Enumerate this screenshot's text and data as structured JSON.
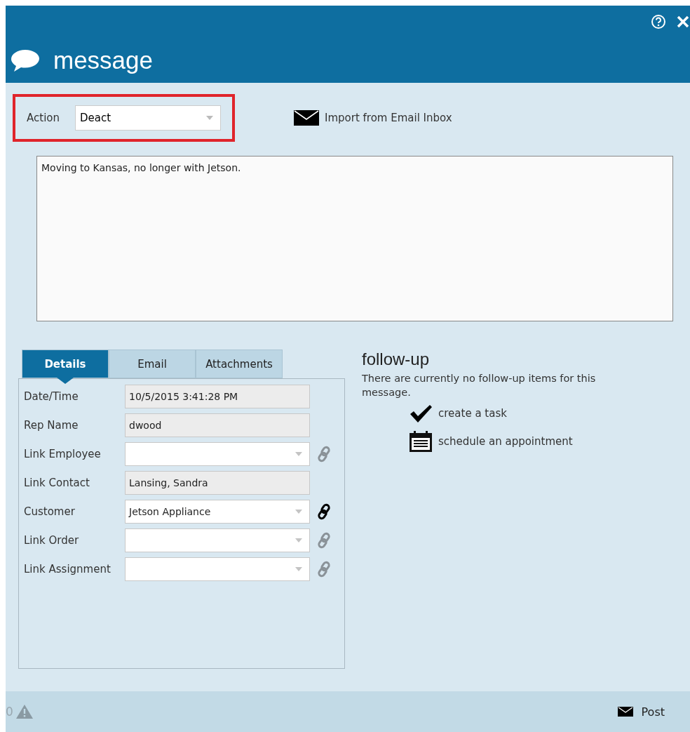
{
  "window": {
    "title": "message"
  },
  "action": {
    "label": "Action",
    "value": "Deact",
    "highlighted": true
  },
  "import_link": "Import from Email Inbox",
  "message_text": "Moving to Kansas, no longer with Jetson.",
  "tabs": [
    {
      "label": "Details",
      "selected": true
    },
    {
      "label": "Email",
      "selected": false
    },
    {
      "label": "Attachments",
      "selected": false
    }
  ],
  "fields": [
    {
      "label": "Date/Time",
      "kind": "readonly",
      "value": "10/5/2015 3:41:28 PM"
    },
    {
      "label": "Rep Name",
      "kind": "readonly",
      "value": "dwood"
    },
    {
      "label": "Link Employee",
      "kind": "dropdown",
      "linked": false
    },
    {
      "label": "Link Contact",
      "kind": "readonly",
      "value": "Lansing, Sandra"
    },
    {
      "label": "Customer",
      "kind": "dropdown",
      "value": "Jetson Appliance",
      "linked": true
    },
    {
      "label": "Link Order",
      "kind": "dropdown",
      "linked": false
    },
    {
      "label": "Link Assignment",
      "kind": "dropdown",
      "linked": false
    }
  ],
  "follow_up": {
    "title": "follow-up",
    "note": "There are currently no follow-up items for this message.",
    "actions": [
      {
        "kind": "task",
        "label": "create a task"
      },
      {
        "kind": "appointment",
        "label": "schedule an appointment"
      }
    ]
  },
  "status_bar": {
    "warning_count": "0",
    "post_label": "Post"
  }
}
